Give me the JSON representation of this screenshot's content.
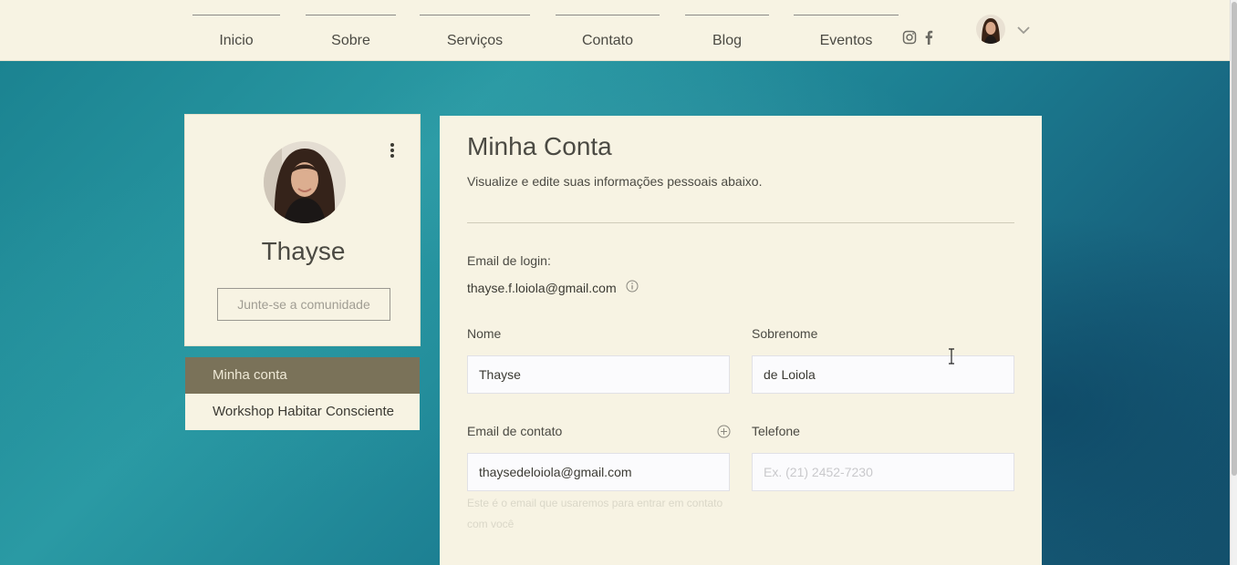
{
  "nav": {
    "items": [
      "Inicio",
      "Sobre",
      "Serviços",
      "Contato",
      "Blog",
      "Eventos"
    ]
  },
  "icons": {
    "instagram": "instagram-icon",
    "facebook": "facebook-icon",
    "dropdown": "chevron-down-icon",
    "more": "more-vertical-icon",
    "info": "info-icon",
    "add": "plus-circle-icon"
  },
  "profile": {
    "name": "Thayse",
    "join_label": "Junte-se a comunidade"
  },
  "menu": {
    "items": [
      "Minha conta",
      "Workshop Habitar Consciente"
    ]
  },
  "account": {
    "title": "Minha Conta",
    "subtitle": "Visualize e edite suas informações pessoais abaixo.",
    "login_email_label": "Email de login:",
    "login_email": "thayse.f.loiola@gmail.com",
    "first_name_label": "Nome",
    "first_name": "Thayse",
    "last_name_label": "Sobrenome",
    "last_name": "de Loiola",
    "contact_email_label": "Email de contato",
    "contact_email": "thaysedeloiola@gmail.com",
    "phone_label": "Telefone",
    "phone_placeholder": "Ex. (21) 2452-7230",
    "contact_hint": "Este é o email que usaremos para entrar em contato com você"
  },
  "colors": {
    "background": "#f7f3e3",
    "active_menu": "#7a7259",
    "hero_teal": "#1b8391"
  }
}
